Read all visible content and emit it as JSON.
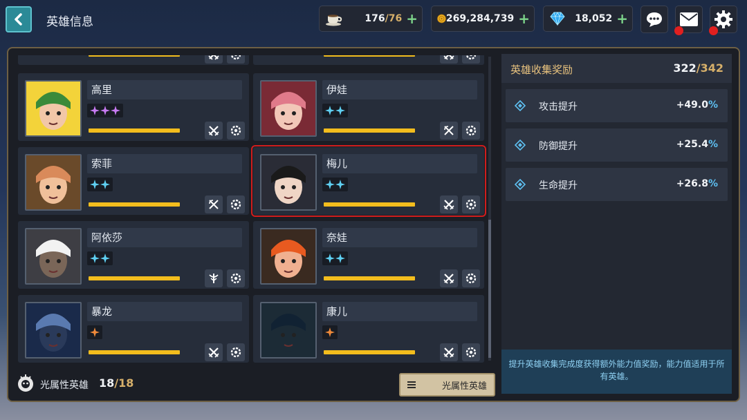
{
  "header": {
    "title": "英雄信息"
  },
  "resources": {
    "stamina": {
      "value": "176",
      "max": "76",
      "separator": "/"
    },
    "gold": {
      "value": "269,284,739"
    },
    "gems": {
      "value": "18,052"
    }
  },
  "heroes": [
    {
      "name": "高里",
      "stars": 3,
      "star_color": "#c77bf2",
      "bar_fill": 1.0,
      "role_icon": "crossed-swords-icon"
    },
    {
      "name": "伊娃",
      "stars": 2,
      "star_color": "#5fd0f2",
      "bar_fill": 1.0,
      "role_icon": "crossed-bows-icon"
    },
    {
      "name": "索菲",
      "stars": 2,
      "star_color": "#5fd0f2",
      "bar_fill": 1.0,
      "role_icon": "crossed-bows-icon"
    },
    {
      "name": "梅儿",
      "stars": 2,
      "star_color": "#5fd0f2",
      "bar_fill": 1.0,
      "role_icon": "crossed-swords-icon"
    },
    {
      "name": "阿依莎",
      "stars": 2,
      "star_color": "#5fd0f2",
      "bar_fill": 1.0,
      "role_icon": "staff-icon"
    },
    {
      "name": "奈娃",
      "stars": 2,
      "star_color": "#5fd0f2",
      "bar_fill": 1.0,
      "role_icon": "crossed-swords-icon"
    },
    {
      "name": "暴龙",
      "stars": 1,
      "star_color": "#f08a3a",
      "bar_fill": 1.0,
      "role_icon": "crossed-swords-icon"
    },
    {
      "name": "康儿",
      "stars": 1,
      "star_color": "#f08a3a",
      "bar_fill": 1.0,
      "role_icon": "crossed-swords-icon"
    }
  ],
  "footer": {
    "label": "光属性英雄",
    "count": "18",
    "separator": "/",
    "max": "18",
    "filter_label": "光属性英雄"
  },
  "collection": {
    "title": "英雄收集奖励",
    "count": "322",
    "separator": "/",
    "max": "342",
    "bonuses": [
      {
        "label": "攻击提升",
        "value": "+49.0",
        "unit": "%"
      },
      {
        "label": "防御提升",
        "value": "+25.4",
        "unit": "%"
      },
      {
        "label": "生命提升",
        "value": "+26.8",
        "unit": "%"
      }
    ],
    "note": "提升英雄收集完成度获得额外能力值奖励，能力值适用于所有英雄。"
  },
  "colors": {
    "accent_gold": "#d7b06a",
    "progress": "#f3bd1d",
    "selection": "#d11d1d",
    "percent": "#5ec0f2"
  }
}
